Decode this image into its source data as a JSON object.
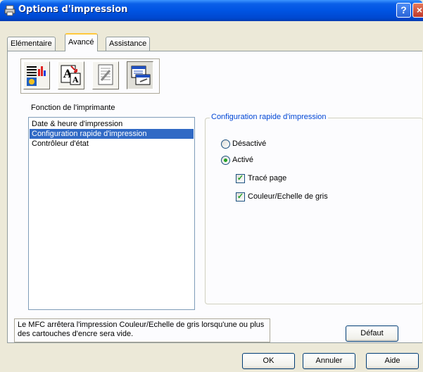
{
  "window": {
    "title": "Options d'impression",
    "help_label": "?",
    "close_label": "×"
  },
  "tabs": [
    {
      "label": "Elémentaire"
    },
    {
      "label": "Avancé"
    },
    {
      "label": "Assistance"
    }
  ],
  "toolbar_icons": [
    "color-settings-icon",
    "scaling-icon",
    "watermark-icon",
    "device-options-icon"
  ],
  "section": {
    "title": "Fonction de l'imprimante"
  },
  "functions": [
    {
      "label": "Date & heure d'impression"
    },
    {
      "label": "Configuration rapide d'impression"
    },
    {
      "label": "Contrôleur d'état"
    }
  ],
  "group": {
    "title": "Configuration rapide d'impression",
    "radio_off": "Désactivé",
    "radio_on": "Activé",
    "selected": "Activé",
    "check_page": "Tracé page",
    "check_color": "Couleur/Echelle de gris",
    "check_page_checked": true,
    "check_color_checked": true
  },
  "status": {
    "text": "Le MFC arrêtera l'impression Couleur/Echelle de gris lorsqu'une ou plus des cartouches d'encre sera vide."
  },
  "buttons": {
    "default": "Défaut",
    "ok": "OK",
    "cancel": "Annuler",
    "help": "Aide"
  },
  "colors": {
    "titlebar": "#0054e3",
    "selection": "#316ac5",
    "group_title": "#0046d5",
    "tab_highlight": "#ffc83c"
  }
}
